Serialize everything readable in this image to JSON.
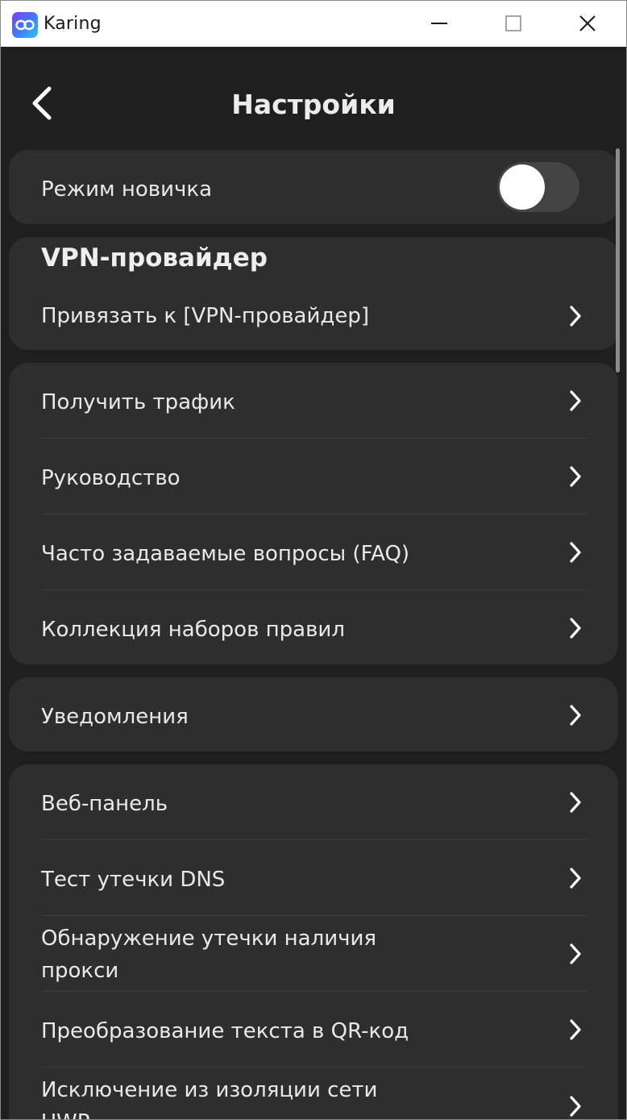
{
  "window": {
    "title": "Karing"
  },
  "header": {
    "title": "Настройки"
  },
  "novice": {
    "label": "Режим новичка",
    "enabled": false
  },
  "vpn": {
    "section_title": "VPN-провайдер",
    "bind_label": "Привязать к [VPN-провайдер]"
  },
  "group1": {
    "items": [
      {
        "label": "Получить трафик"
      },
      {
        "label": "Руководство"
      },
      {
        "label": "Часто задаваемые вопросы (FAQ)"
      },
      {
        "label": "Коллекция наборов правил"
      }
    ]
  },
  "notifications": {
    "label": "Уведомления"
  },
  "group2": {
    "items": [
      {
        "label": "Веб-панель"
      },
      {
        "label": "Тест утечки DNS"
      },
      {
        "label": "Обнаружение утечки наличия прокси"
      },
      {
        "label": "Преобразование текста в QR-код"
      },
      {
        "label": "Исключение из изоляции сети UWP"
      }
    ]
  },
  "colors": {
    "background": "#1f1f1f",
    "card": "#2e2e2e",
    "text": "#ececec",
    "toggle_track": "#444444"
  }
}
